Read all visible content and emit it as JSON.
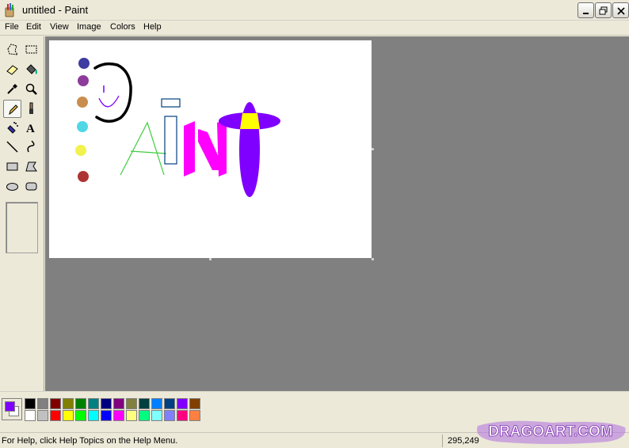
{
  "window": {
    "title": "untitled - Paint"
  },
  "menu": [
    "File",
    "Edit",
    "View",
    "Image",
    "Colors",
    "Help"
  ],
  "tools": [
    {
      "name": "free-form-select-tool",
      "icon": "free-form-select-icon"
    },
    {
      "name": "rectangle-select-tool",
      "icon": "rectangle-select-icon"
    },
    {
      "name": "eraser-tool",
      "icon": "eraser-icon"
    },
    {
      "name": "fill-with-color-tool",
      "icon": "paint-bucket-icon"
    },
    {
      "name": "pick-color-tool",
      "icon": "eyedropper-icon"
    },
    {
      "name": "magnifier-tool",
      "icon": "magnifier-icon"
    },
    {
      "name": "pencil-tool",
      "icon": "pencil-icon",
      "selected": true
    },
    {
      "name": "brush-tool",
      "icon": "brush-icon"
    },
    {
      "name": "airbrush-tool",
      "icon": "airbrush-icon"
    },
    {
      "name": "text-tool",
      "icon": "text-icon"
    },
    {
      "name": "line-tool",
      "icon": "line-icon"
    },
    {
      "name": "curve-tool",
      "icon": "curve-icon"
    },
    {
      "name": "rectangle-tool",
      "icon": "rectangle-icon"
    },
    {
      "name": "polygon-tool",
      "icon": "polygon-icon"
    },
    {
      "name": "ellipse-tool",
      "icon": "ellipse-icon"
    },
    {
      "name": "rounded-rectangle-tool",
      "icon": "rounded-rectangle-icon"
    }
  ],
  "colors": {
    "foreground": "#8000ff",
    "background": "#ffffff",
    "palette_top": [
      "#000000",
      "#808080",
      "#800000",
      "#808000",
      "#008000",
      "#008080",
      "#000080",
      "#800080",
      "#808040",
      "#004040",
      "#0080ff",
      "#004080",
      "#8000ff",
      "#804000"
    ],
    "palette_bottom": [
      "#ffffff",
      "#c0c0c0",
      "#ff0000",
      "#ffff00",
      "#00ff00",
      "#00ffff",
      "#0000ff",
      "#ff00ff",
      "#ffff80",
      "#00ff80",
      "#80ffff",
      "#8080ff",
      "#ff0080",
      "#ff8040"
    ]
  },
  "status": {
    "help_text": "For Help, click Help Topics on the Help Menu.",
    "coordinates": "295,249"
  },
  "watermark": {
    "text": "DRAGOART.COM"
  }
}
